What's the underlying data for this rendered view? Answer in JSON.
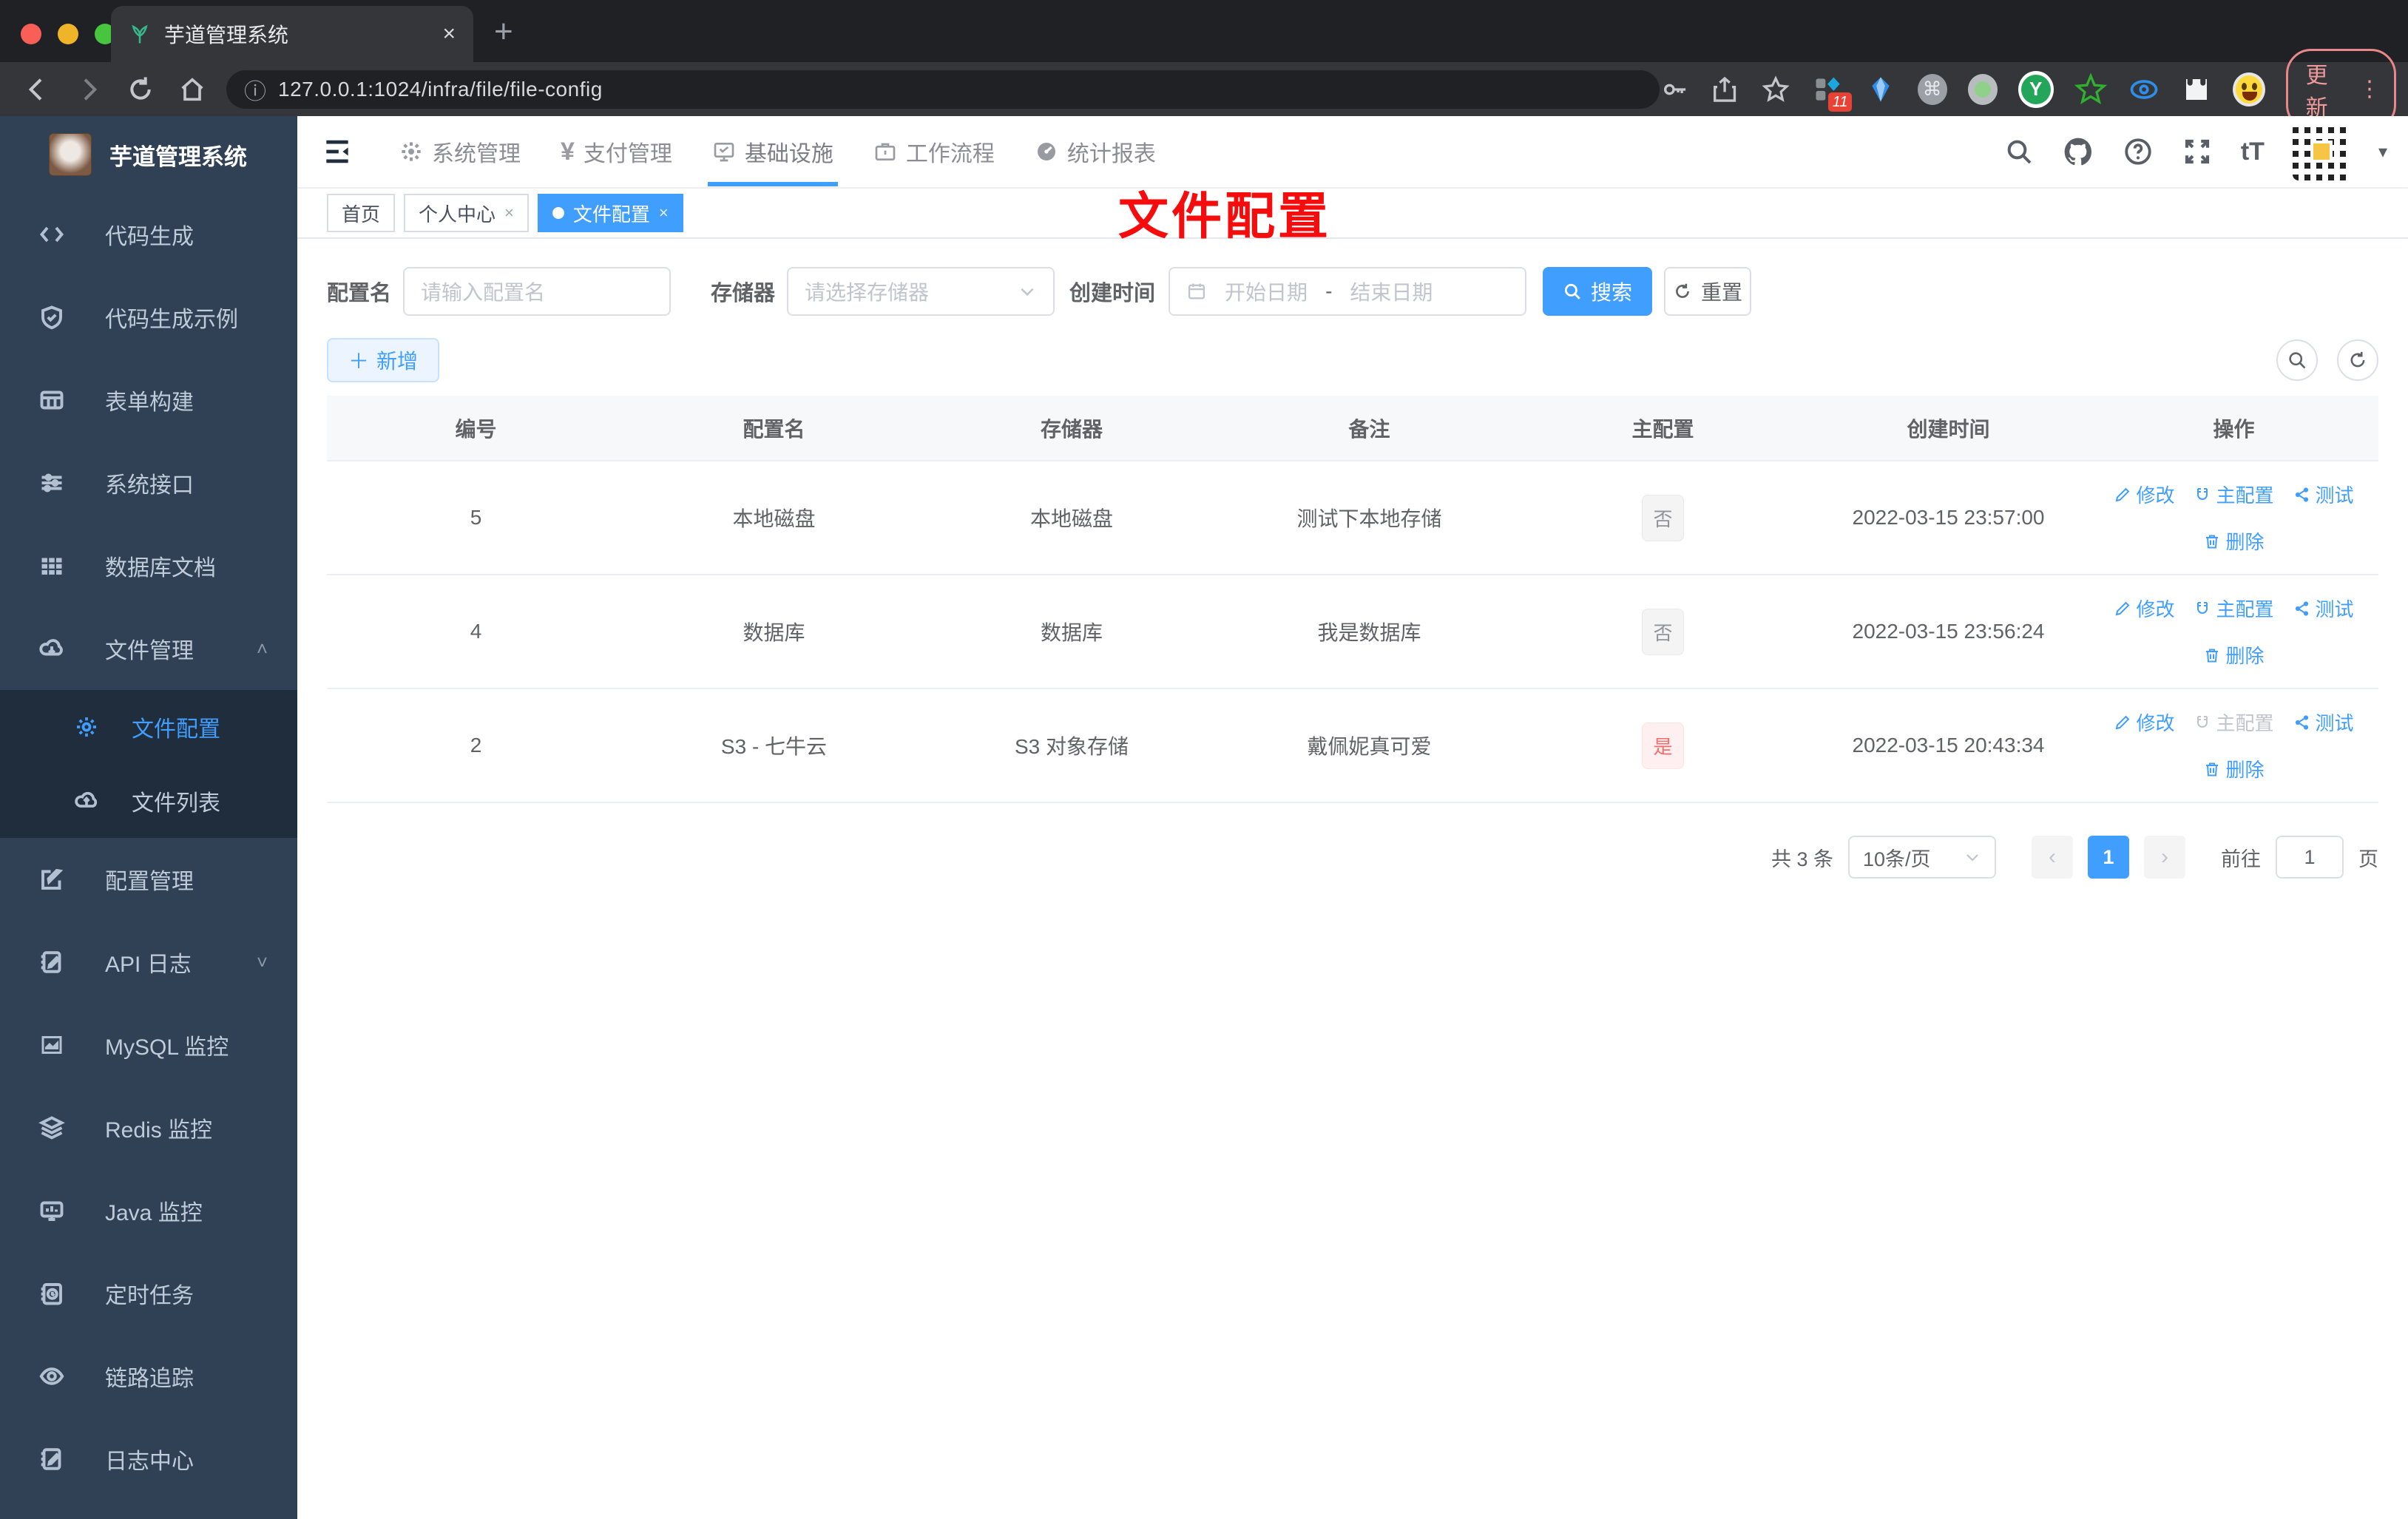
{
  "browser": {
    "tab_title": "芋道管理系统",
    "url": "127.0.0.1:1024/infra/file/file-config",
    "update_label": "更新",
    "extension_badge": "11"
  },
  "icons": {
    "close": "×",
    "plus": "＋",
    "newtab": "+",
    "kebab": "⋮",
    "caret_down": "▾",
    "prev": "‹",
    "next": "›",
    "cmd": "⌘",
    "y": "Y",
    "yen": "¥",
    "question": "?",
    "font_size": "tT",
    "info": "ⓘ",
    "dash": "-",
    "tag_close": "×"
  },
  "sidebar": {
    "title": "芋道管理系统",
    "items": {
      "codegen": "代码生成",
      "codegen_demo": "代码生成示例",
      "form_builder": "表单构建",
      "system_api": "系统接口",
      "db_doc": "数据库文档",
      "file_mgmt": "文件管理",
      "file_config": "文件配置",
      "file_list": "文件列表",
      "config_mgmt": "配置管理",
      "api_log": "API 日志",
      "mysql": "MySQL 监控",
      "redis": "Redis 监控",
      "java": "Java 监控",
      "cron": "定时任务",
      "trace": "链路追踪",
      "log_center": "日志中心"
    }
  },
  "topnav": {
    "system": "系统管理",
    "payment": "支付管理",
    "infra": "基础设施",
    "workflow": "工作流程",
    "report": "统计报表"
  },
  "tags": {
    "home": "首页",
    "profile": "个人中心",
    "file_config": "文件配置"
  },
  "annotation": "文件配置",
  "filters": {
    "name_label": "配置名",
    "name_placeholder": "请输入配置名",
    "storage_label": "存储器",
    "storage_placeholder": "请选择存储器",
    "date_label": "创建时间",
    "date_start": "开始日期",
    "date_end": "结束日期",
    "search": "搜索",
    "reset": "重置",
    "add": "新增"
  },
  "table": {
    "headers": [
      "编号",
      "配置名",
      "存储器",
      "备注",
      "主配置",
      "创建时间",
      "操作"
    ],
    "actions": {
      "edit": "修改",
      "master": "主配置",
      "test": "测试",
      "delete": "删除"
    },
    "rows": [
      {
        "id": "5",
        "name": "本地磁盘",
        "storage": "本地磁盘",
        "remark": "测试下本地存储",
        "master": "否",
        "created": "2022-03-15 23:57:00"
      },
      {
        "id": "4",
        "name": "数据库",
        "storage": "数据库",
        "remark": "我是数据库",
        "master": "否",
        "created": "2022-03-15 23:56:24"
      },
      {
        "id": "2",
        "name": "S3 - 七牛云",
        "storage": "S3 对象存储",
        "remark": "戴佩妮真可爱",
        "master": "是",
        "created": "2022-03-15 20:43:34"
      }
    ]
  },
  "pagination": {
    "total": "共 3 条",
    "page_size": "10条/页",
    "page": "1",
    "goto": "前往",
    "goto_value": "1",
    "unit": "页"
  },
  "colors": {
    "accent": "#409eff",
    "danger": "#f56c6c",
    "sidebar_bg": "#304156",
    "submenu_bg": "#1f2d3d"
  }
}
